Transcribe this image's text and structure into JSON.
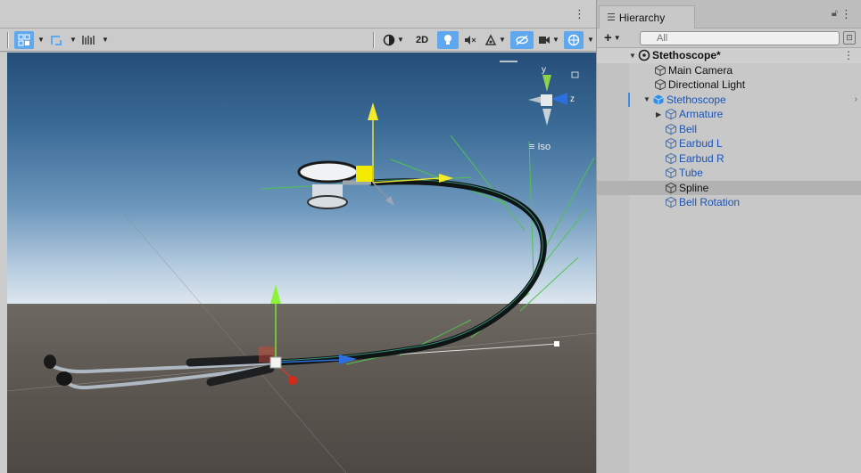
{
  "scene": {
    "toolbar": {
      "two_d_label": "2D"
    },
    "viewport": {
      "gizmo": {
        "y_label": "y",
        "z_label": "z"
      },
      "projection_label": "Iso"
    },
    "colors": {
      "accent": "#5fa8ef",
      "axis_y": "#c8d400",
      "axis_x": "#d03a2a",
      "axis_z": "#2d6fe0"
    }
  },
  "hierarchy": {
    "tab_label": "Hierarchy",
    "search_placeholder": "All",
    "scene_name": "Stethoscope*",
    "items": [
      {
        "label": "Main Camera",
        "prefab": false
      },
      {
        "label": "Directional Light",
        "prefab": false
      },
      {
        "label": "Stethoscope",
        "prefab": true
      },
      {
        "label": "Armature",
        "prefab": true
      },
      {
        "label": "Bell",
        "prefab": true
      },
      {
        "label": "Earbud L",
        "prefab": true
      },
      {
        "label": "Earbud R",
        "prefab": true
      },
      {
        "label": "Tube",
        "prefab": true
      },
      {
        "label": "Spline",
        "prefab": false
      },
      {
        "label": "Bell Rotation",
        "prefab": true
      }
    ]
  }
}
